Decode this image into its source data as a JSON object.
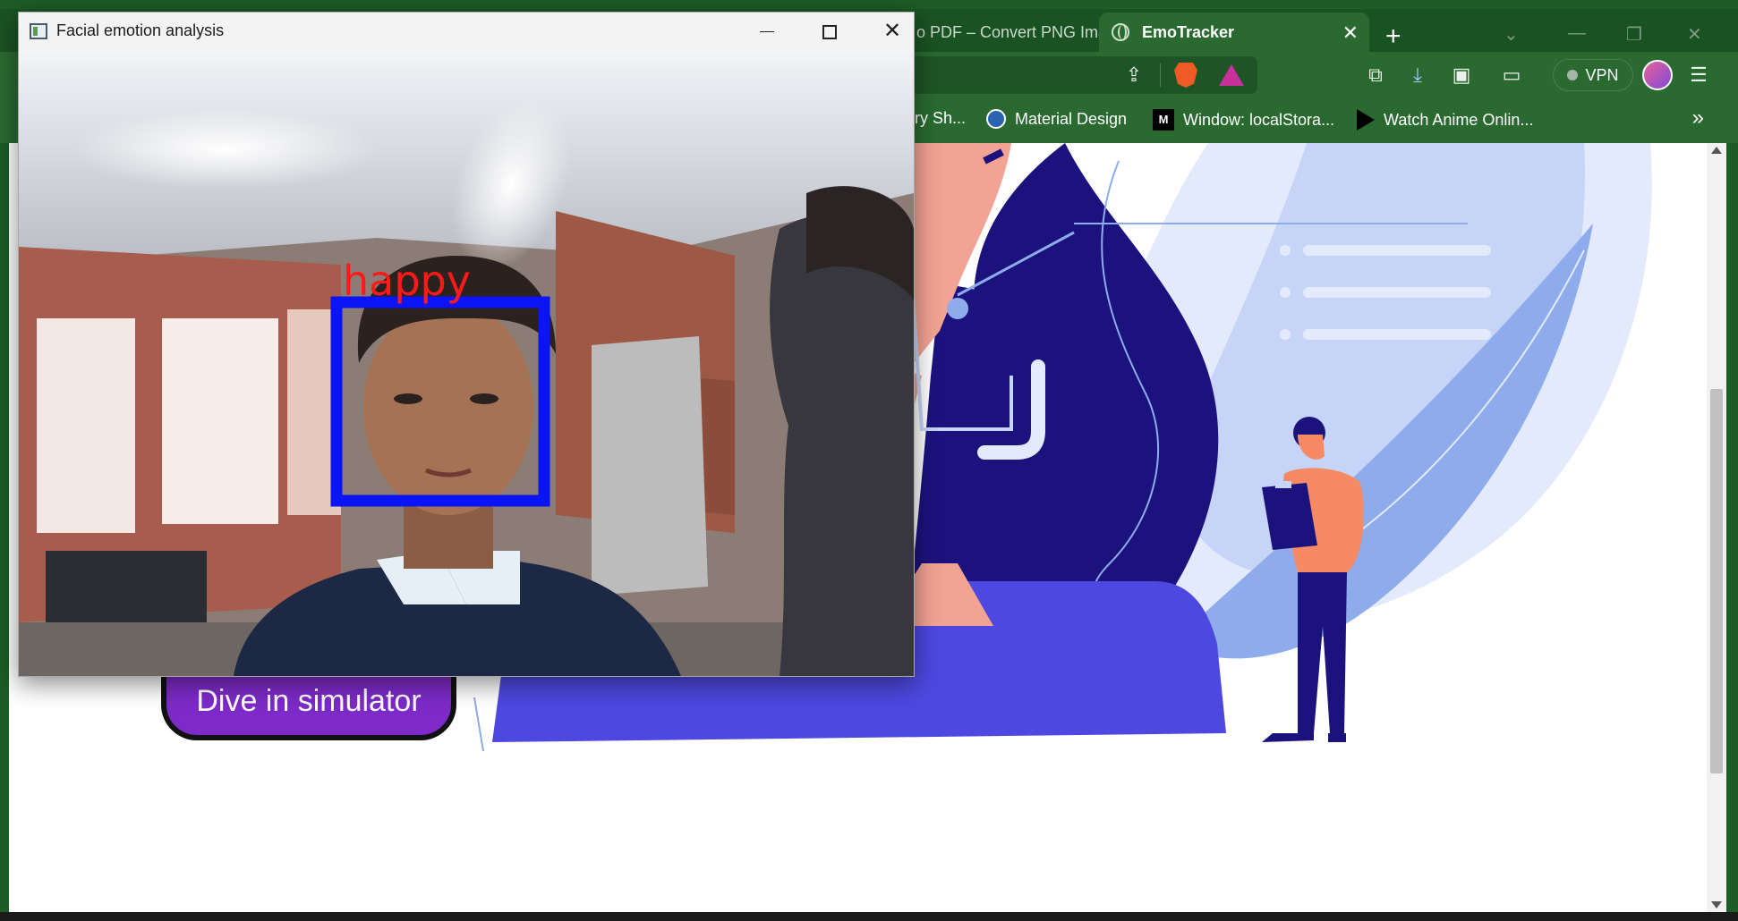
{
  "browser": {
    "tabs": [
      {
        "label": "o PDF – Convert PNG Ima",
        "active": false
      },
      {
        "label": "EmoTracker",
        "active": true
      }
    ],
    "new_tab_symbol": "+",
    "tab_close_symbol": "✕",
    "vpn_label": "VPN",
    "bookmarks": [
      {
        "label": "ery Sh...",
        "icon": "none"
      },
      {
        "label": "Material Design",
        "icon": "material-icon"
      },
      {
        "label": "Window: localStora...",
        "icon": "mdn-icon"
      },
      {
        "label": "Watch Anime Onlin...",
        "icon": "play-icon"
      }
    ],
    "bookmarks_overflow": "»",
    "mdn_glyph": "M"
  },
  "page": {
    "simulator_button": "Dive in simulator",
    "palette": {
      "purple": "#7d2ac8",
      "navy": "#1c127e",
      "violet": "#4d48e0",
      "salmon": "#f3a394",
      "sky": "#c6d5f7",
      "orange": "#f58a64"
    }
  },
  "cv_window": {
    "title": "Facial emotion analysis",
    "emotion_label": "happy",
    "box_color": "#0a14f5",
    "label_color": "#ff1a1a"
  }
}
